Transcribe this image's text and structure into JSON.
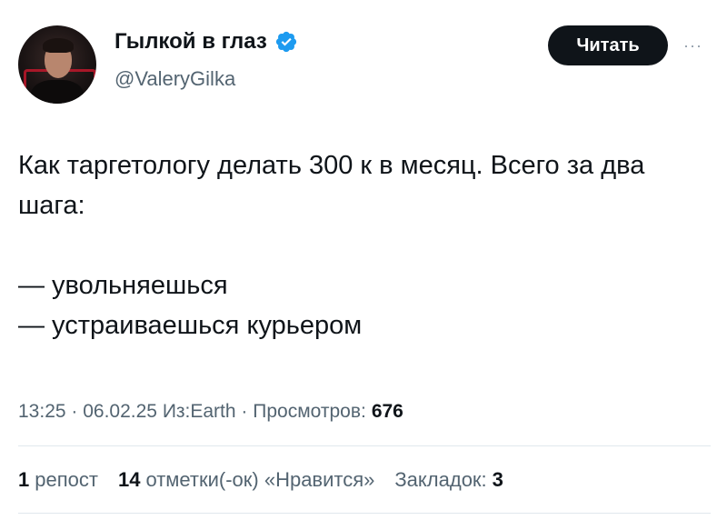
{
  "author": {
    "display_name": "Гылкой в глаз",
    "handle": "@ValeryGilka",
    "verified_icon": "verified-badge-icon",
    "badge_color": "#1d9bf0"
  },
  "follow_button": {
    "label": "Читать"
  },
  "more_icon": {
    "glyph": "···",
    "icon": "more-icon"
  },
  "tweet": {
    "text": "Как таргетологу делать 300 к в месяц. Всего за два шага:\n\n— увольняешься\n— устраиваешься курьером"
  },
  "meta": {
    "time": "13:25",
    "sep1": " · ",
    "date": "06.02.25",
    "source": " Из:Earth",
    "sep2": " · ",
    "views_label": "Просмотров:",
    "views_count": "676"
  },
  "stats": {
    "reposts_count": "1",
    "reposts_label": "репост",
    "quotes_count": "14",
    "quotes_label": "отметки(-ок) «Нравится»",
    "bookmarks_label": "Закладок:",
    "bookmarks_count": "3"
  }
}
